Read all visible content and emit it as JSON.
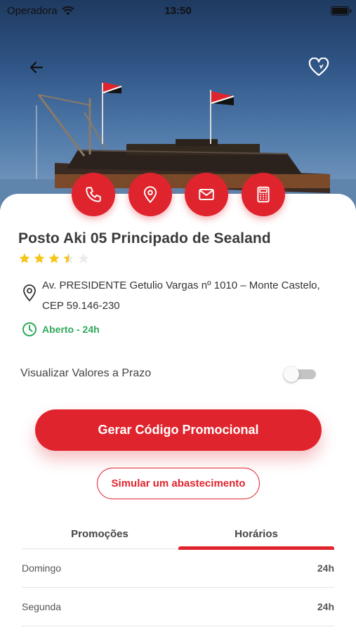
{
  "status_bar": {
    "carrier": "Operadora",
    "time": "13:50"
  },
  "station": {
    "name": "Posto Aki 05 Principado de Sealand",
    "rating": 3.5,
    "address_line1": "Av. PRESIDENTE Getulio Vargas nº 1010 – Monte Castelo,",
    "address_line2": "CEP 59.146-230",
    "status": "Aberto - 24h"
  },
  "toggle": {
    "label": "Visualizar Valores a Prazo",
    "on": false
  },
  "buttons": {
    "generate_code": "Gerar Código Promocional",
    "simulate": "Simular um abastecimento"
  },
  "tabs": [
    {
      "label": "Promoções",
      "active": false
    },
    {
      "label": "Horários",
      "active": true
    }
  ],
  "hours": [
    {
      "day": "Domingo",
      "value": "24h"
    },
    {
      "day": "Segunda",
      "value": "24h"
    }
  ],
  "colors": {
    "accent": "#e0242d",
    "open": "#2fa85a",
    "star": "#f5c518"
  },
  "icons": {
    "back": "arrow-left-icon",
    "favorite": "heart-icon",
    "call": "phone-icon",
    "map": "map-pin-icon",
    "email": "mail-icon",
    "calculator": "calculator-icon",
    "address": "location-pin-icon",
    "hours": "clock-icon"
  }
}
